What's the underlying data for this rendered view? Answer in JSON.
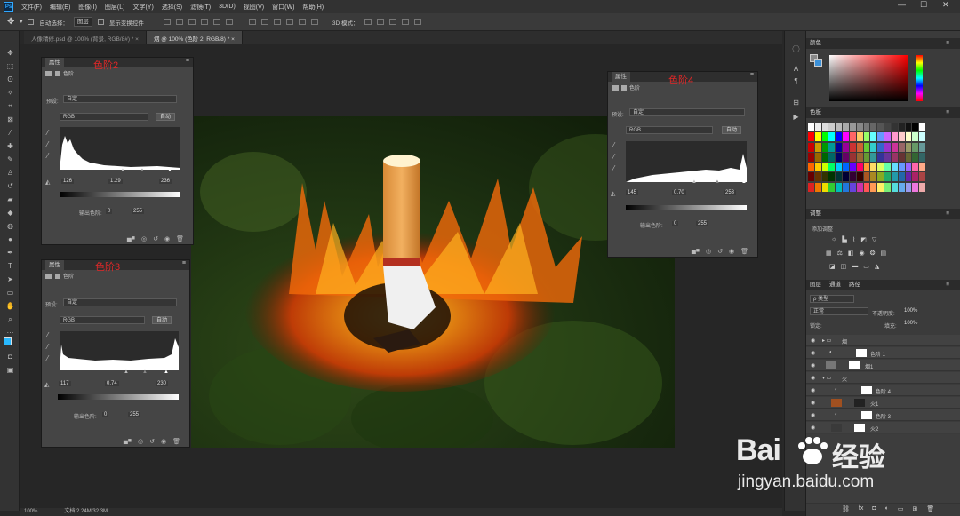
{
  "menubar": {
    "app_icon": "Ps",
    "items": [
      "文件(F)",
      "编辑(E)",
      "图像(I)",
      "图层(L)",
      "文字(Y)",
      "选择(S)",
      "滤镜(T)",
      "3D(D)",
      "视图(V)",
      "窗口(W)",
      "帮助(H)"
    ],
    "minimize": "—",
    "maximize": "☐",
    "close": "✕"
  },
  "options": {
    "auto_select_label": "自动选择：",
    "auto_select_value": "图层",
    "show_transform": "显示变换控件",
    "mode_3d": "3D 模式："
  },
  "tabs": [
    {
      "label": "人像精修.psd @ 100% (背景, RGB/8#) *",
      "close": "×"
    },
    {
      "label": "烟 @ 100% (色阶 2, RGB/8) *",
      "close": "×"
    }
  ],
  "levels_panels": [
    {
      "title_red": "色阶2",
      "tab": "属性",
      "sub": "色阶",
      "preset_label": "预设:",
      "preset": "自定",
      "channel": "RGB",
      "auto": "自动",
      "in_black": "126",
      "in_gamma": "1.29",
      "in_white": "236",
      "out_label": "输出色阶:",
      "out_black": "0",
      "out_white": "255"
    },
    {
      "title_red": "色阶3",
      "tab": "属性",
      "sub": "色阶",
      "preset_label": "预设:",
      "preset": "自定",
      "channel": "RGB",
      "auto": "自动",
      "in_black": "117",
      "in_gamma": "0.74",
      "in_white": "230",
      "out_label": "输出色阶:",
      "out_black": "0",
      "out_white": "255"
    },
    {
      "title_red": "色阶4",
      "tab": "属性",
      "sub": "色阶",
      "preset_label": "预设:",
      "preset": "自定",
      "channel": "RGB",
      "auto": "自动",
      "in_black": "145",
      "in_gamma": "0.70",
      "in_white": "253",
      "out_label": "输出色阶:",
      "out_black": "0",
      "out_white": "255"
    }
  ],
  "right": {
    "color_tab": "颜色",
    "swatches_tab": "色板",
    "adjust_tab": "调整",
    "adjust_add": "添加调整",
    "layer_tabs": [
      "图层",
      "通道",
      "路径"
    ],
    "kind": "ρ 类型",
    "blend": "正常",
    "opacity_label": "不透明度:",
    "opacity": "100%",
    "lock_label": "锁定:",
    "fill_label": "填充:",
    "fill": "100%",
    "layers": [
      {
        "name": "烟",
        "type": "group"
      },
      {
        "name": "色阶 1",
        "type": "adj"
      },
      {
        "name": "烟1",
        "type": "mask"
      },
      {
        "name": "火",
        "type": "group"
      },
      {
        "name": "色阶 4",
        "type": "adj"
      },
      {
        "name": "火1",
        "type": "img"
      },
      {
        "name": "色阶 3",
        "type": "adj"
      },
      {
        "name": "火2",
        "type": "img"
      }
    ]
  },
  "status": {
    "zoom": "100%",
    "doc": "文档:2.24M/32.3M"
  },
  "watermark": {
    "brand": "Bai",
    "brand2": "经验",
    "url": "jingyan.baidu.com"
  },
  "colors": {
    "accent": "#31a8ff",
    "red_note": "#e02828",
    "ui_dark": "#323232"
  }
}
